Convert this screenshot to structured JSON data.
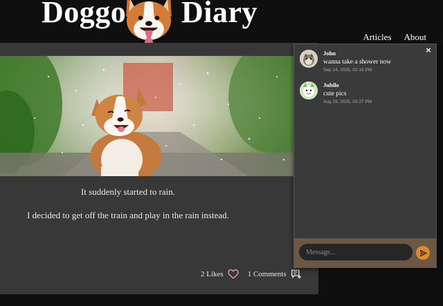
{
  "header": {
    "title_left": "Doggo",
    "title_right": "Diary",
    "nav": [
      {
        "label": "Articles"
      },
      {
        "label": "About"
      }
    ]
  },
  "post": {
    "paragraphs": [
      "It suddenly started to rain.",
      "I decided to get off the train and play in the rain instead."
    ],
    "likes_label": "2 Likes",
    "comments_label": "1 Comments",
    "heart_icon": "heart-outline-icon",
    "comment_icon": "comment-add-icon"
  },
  "chat": {
    "close_label": "×",
    "messages": [
      {
        "author": "John",
        "text": "wanna take a shower now",
        "time": "Sep 14, 2025, 02:18 PM"
      },
      {
        "author": "Jubilo",
        "text": "cute pics",
        "time": "Aug 19, 2025, 03:27 PM"
      }
    ],
    "input_placeholder": "Message...",
    "send_icon": "send-icon"
  },
  "colors": {
    "page_bg": "#0f0f0f",
    "card_bg": "#383838",
    "chat_bg": "#3a3a3a",
    "composer_bg": "#6b5843",
    "accent": "#e08a2c"
  }
}
